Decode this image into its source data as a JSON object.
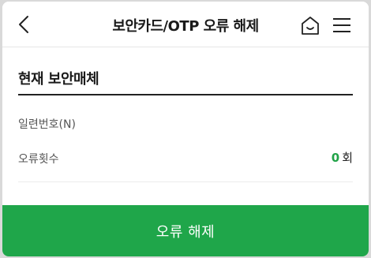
{
  "header": {
    "title": "보안카드/OTP 오류 해제",
    "back_icon": "chevron-left-icon",
    "home_icon": "home-icon",
    "menu_icon": "hamburger-menu-icon"
  },
  "section": {
    "title": "현재 보안매체"
  },
  "rows": {
    "serial_label": "일련번호(N)",
    "errors_label": "오류횟수",
    "errors_count": "0",
    "errors_unit": "회"
  },
  "actions": {
    "release_label": "오류 해제"
  },
  "colors": {
    "accent": "#1fa64a",
    "count_color": "#21a348"
  }
}
